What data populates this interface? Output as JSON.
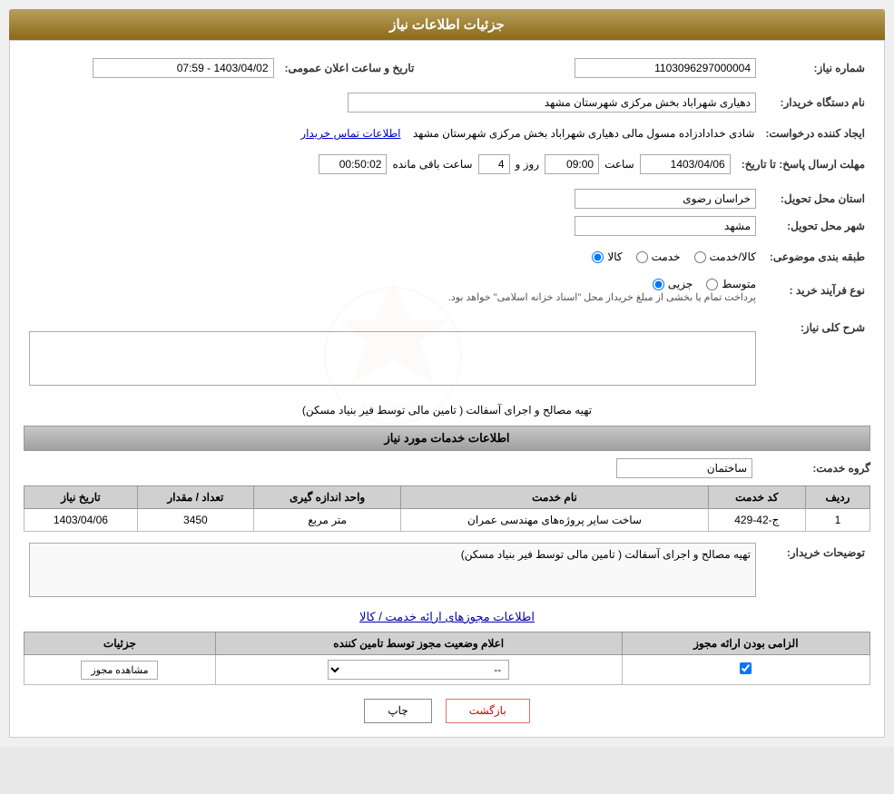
{
  "page": {
    "title": "جزئیات اطلاعات نیاز"
  },
  "header": {
    "section_info": "اطلاعات خدمات مورد نیاز",
    "section_permits": "اطلاعات مجوزهای ارائه خدمت / کالا"
  },
  "fields": {
    "need_number_label": "شماره نیاز:",
    "need_number_value": "1103096297000004",
    "buyer_org_label": "نام دستگاه خریدار:",
    "buyer_org_value": "دهیاری شهراباد بخش مرکزی شهرستان مشهد",
    "requester_label": "ایجاد کننده درخواست:",
    "requester_value": "شادی خدادادزاده مسول مالی دهیاری شهراباد بخش مرکزی شهرستان مشهد",
    "contact_link": "اطلاعات تماس خریدار",
    "deadline_label": "مهلت ارسال پاسخ: تا تاریخ:",
    "deadline_date": "1403/04/06",
    "deadline_time_label": "ساعت",
    "deadline_time": "09:00",
    "deadline_days_label": "روز و",
    "deadline_days": "4",
    "deadline_remaining_label": "ساعت باقی مانده",
    "deadline_remaining": "00:50:02",
    "announce_label": "تاریخ و ساعت اعلان عمومی:",
    "announce_value": "1403/04/02 - 07:59",
    "province_label": "استان محل تحویل:",
    "province_value": "خراسان رضوی",
    "city_label": "شهر محل تحویل:",
    "city_value": "مشهد",
    "category_label": "طبقه بندی موضوعی:",
    "category_kala": "کالا",
    "category_khadamat": "خدمت",
    "category_kala_khadamat": "کالا/خدمت",
    "purchase_type_label": "نوع فرآیند خرید :",
    "purchase_jozi": "جزیی",
    "purchase_mutavasset": "متوسط",
    "purchase_note": "پرداخت تمام یا بخشی از مبلغ خریداز محل \"اسناد خزانه اسلامی\" خواهد بود.",
    "general_desc_label": "شرح کلی نیاز:",
    "general_desc_value": "تهیه مصالح و اجرای آسفالت ( تامین مالی توسط فیر بنیاد مسکن)",
    "group_service_label": "گروه خدمت:",
    "group_service_value": "ساختمان"
  },
  "table": {
    "headers": [
      "ردیف",
      "کد خدمت",
      "نام خدمت",
      "واحد اندازه گیری",
      "تعداد / مقدار",
      "تاریخ نیاز"
    ],
    "rows": [
      {
        "row": "1",
        "code": "ج-42-429",
        "name": "ساخت سایر پروژه‌های مهندسی عمران",
        "unit": "متر مربع",
        "quantity": "3450",
        "date": "1403/04/06"
      }
    ]
  },
  "buyer_desc_label": "توضیحات خریدار:",
  "buyer_desc_value": "تهیه مصالح و اجرای آسفالت ( تامین مالی توسط فیر بنیاد مسکن)",
  "permits_table": {
    "headers": [
      "الزامی بودن ارائه مجوز",
      "اعلام وضعیت مجوز توسط تامین کننده",
      "جزئیات"
    ],
    "rows": [
      {
        "required": true,
        "status_options": [
          "--"
        ],
        "status_selected": "--",
        "view_label": "مشاهده مجوز"
      }
    ]
  },
  "buttons": {
    "print": "چاپ",
    "back": "بازگشت"
  }
}
